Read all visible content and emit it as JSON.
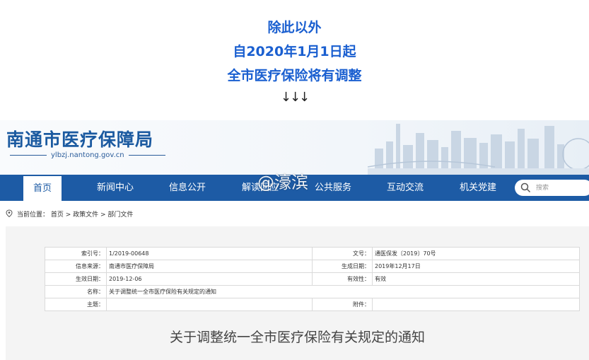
{
  "intro": {
    "line1": "除此以外",
    "line2": "自2020年1月1日起",
    "line3": "全市医疗保险将有调整",
    "arrows": "↓↓↓"
  },
  "site": {
    "title": "南通市医疗保障局",
    "url": "ylbzj.nantong.gov.cn",
    "watermark": "@濠滨"
  },
  "nav": {
    "items": [
      "首页",
      "新闻中心",
      "信息公开",
      "解读回应",
      "公共服务",
      "互动交流",
      "机关党建"
    ],
    "active": "首页",
    "search_placeholder": "搜索"
  },
  "breadcrumb": {
    "prefix": "当前位置：",
    "path": "首页 > 政策文件 > 部门文件"
  },
  "meta": {
    "index_label": "索引号：",
    "index_value": "1/2019-00648",
    "docno_label": "文号：",
    "docno_value": "通医保发〔2019〕70号",
    "source_label": "信息来源：",
    "source_value": "南通市医疗保障局",
    "created_label": "生成日期：",
    "created_value": "2019年12月17日",
    "effective_label": "生效日期：",
    "effective_value": "2019-12-06",
    "validity_label": "有效性：",
    "validity_value": "有效",
    "name_label": "名称：",
    "name_value": "关于调整统一全市医疗保险有关规定的通知",
    "topic_label": "主题：",
    "topic_value": "",
    "attach_label": "附件：",
    "attach_value": ""
  },
  "document": {
    "title": "关于调整统一全市医疗保险有关规定的通知"
  },
  "colors": {
    "accent": "#1a5fd0",
    "nav": "#1d5ba5"
  }
}
